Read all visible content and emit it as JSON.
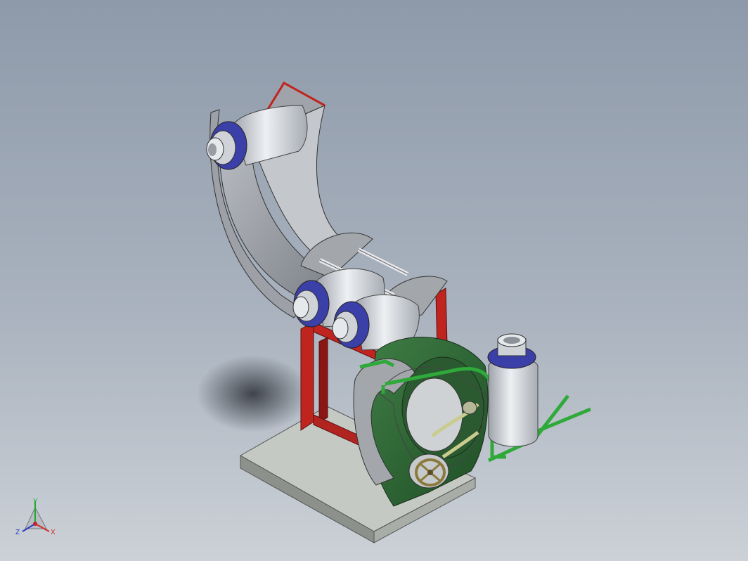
{
  "viewport": {
    "background_top": "#8e9aaa",
    "background_bottom": "#ccd1d7"
  },
  "model": {
    "colors": {
      "frame_red": "#c0241f",
      "gray_part": "#a3a7ab",
      "green_part": "#2f6b35",
      "pipe_green": "#2ea93a",
      "base_plate": "#bfc3bf",
      "bottle_body": "#d9dde2",
      "bottle_ring": "#3b3fa8",
      "handwheel": "#8c7a3c"
    },
    "parts": [
      "curved-chute",
      "bottle",
      "guide-rods",
      "support-frame",
      "green-rotary-wheel",
      "handwheel",
      "standing-bottle",
      "green-pipes",
      "base-plate"
    ]
  },
  "triad": {
    "y": "Y",
    "x": "X",
    "z": "Z",
    "y_color": "#1faa2e",
    "x_color": "#d22a2a",
    "z_color": "#2a3ac8"
  }
}
